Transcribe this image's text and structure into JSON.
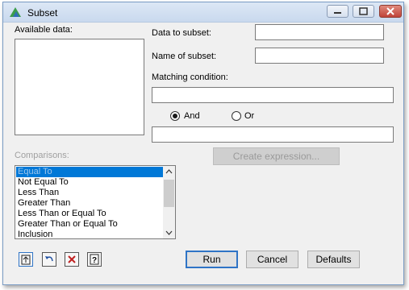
{
  "window": {
    "title": "Subset"
  },
  "left": {
    "available_data_label": "Available data:",
    "comparisons_label": "Comparisons:",
    "comparisons": [
      "Equal To",
      "Not Equal To",
      "Less Than",
      "Greater Than",
      "Less Than or Equal To",
      "Greater Than or Equal To",
      "Inclusion"
    ],
    "selected_comparison": "Equal To"
  },
  "form": {
    "data_to_subset_label": "Data to subset:",
    "data_to_subset_value": "",
    "name_of_subset_label": "Name of subset:",
    "name_of_subset_value": "",
    "matching_condition_label": "Matching condition:",
    "matching_condition_value": "",
    "expression_value": "",
    "and_label": "And",
    "or_label": "Or",
    "logic_selected": "And",
    "create_expression_label": "Create expression..."
  },
  "footer": {
    "run_label": "Run",
    "cancel_label": "Cancel",
    "defaults_label": "Defaults"
  },
  "colors": {
    "selection": "#0078d7",
    "titlebar": "#dce7f5",
    "close_button": "#c0443a"
  }
}
